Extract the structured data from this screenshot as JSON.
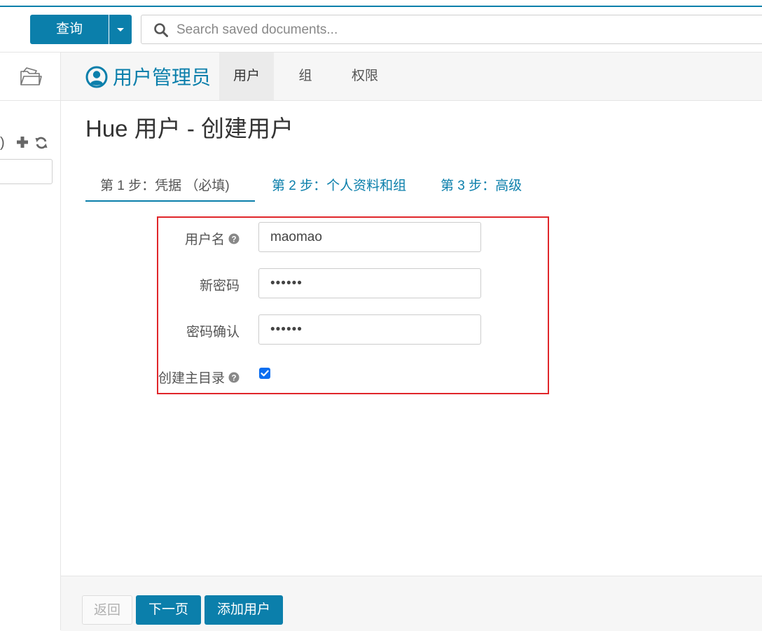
{
  "topbar": {
    "query_button": "查询",
    "search": {
      "placeholder": "Search saved documents...",
      "value": ""
    }
  },
  "sidebar": {
    "paren": ")"
  },
  "app": {
    "title": "用户管理员",
    "tabs": [
      {
        "label": "用户",
        "active": true
      },
      {
        "label": "组",
        "active": false
      },
      {
        "label": "权限",
        "active": false
      }
    ]
  },
  "page": {
    "title": "Hue 用户 - 创建用户"
  },
  "steps": [
    {
      "label": "第 1 步：凭据 （必填)",
      "active": true
    },
    {
      "label": "第 2 步：个人资料和组",
      "active": false
    },
    {
      "label": "第 3 步：高级",
      "active": false
    }
  ],
  "form": {
    "username": {
      "label": "用户名",
      "value": "maomao"
    },
    "new_password": {
      "label": "新密码",
      "value": "••••••"
    },
    "confirm_password": {
      "label": "密码确认",
      "value": "••••••"
    },
    "create_home": {
      "label": "创建主目录",
      "checked": true
    }
  },
  "footer": {
    "back": "返回",
    "next": "下一页",
    "add_user": "添加用户"
  },
  "colors": {
    "accent": "#0b7fab",
    "highlight": "#e0262a",
    "checkbox": "#0b6ef0"
  }
}
